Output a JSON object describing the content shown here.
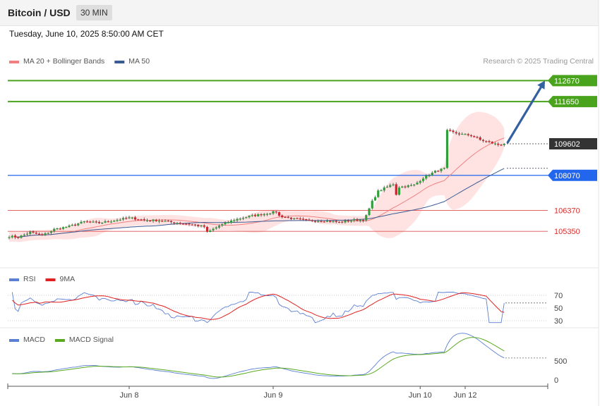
{
  "header": {
    "title": "Bitcoin / USD",
    "timeframe": "30 MIN"
  },
  "date_label": "Tuesday, June 10, 2025 8:50:00 AM CET",
  "copyright": "Research © 2025 Trading Central",
  "colors": {
    "price_text": "#333333",
    "resistance": "#4aa31c",
    "support_blue": "#2266ee",
    "support_red": "#e05050",
    "ma20": "#f08080",
    "ma50": "#3a5a92",
    "band_fill": "#ffdede",
    "candle_up": "#2f9e3b",
    "candle_down": "#c8262e",
    "last_price_bg": "#333333",
    "arrow": "#33609e",
    "rsi": "#5b7fd3",
    "rsi_ma": "#e12020",
    "macd": "#5b7fd3",
    "macd_signal": "#5aaa20"
  },
  "chart_data": [
    {
      "type": "candlestick",
      "panel": "price",
      "legend": [
        {
          "label": "MA 20 + Bollinger Bands",
          "color": "#f08080"
        },
        {
          "label": "MA 50",
          "color": "#3a5a92"
        }
      ],
      "levels": [
        {
          "value": 112670,
          "label": "112670",
          "kind": "resistance",
          "style": "line",
          "color": "#4aa31c"
        },
        {
          "value": 111650,
          "label": "111650",
          "kind": "resistance",
          "style": "line",
          "color": "#4aa31c"
        },
        {
          "value": 109602,
          "label": "109602",
          "kind": "last",
          "style": "dotted",
          "color": "#333333"
        },
        {
          "value": 108070,
          "label": "108070",
          "kind": "pivot",
          "style": "line",
          "color": "#2266ee"
        },
        {
          "value": 106370,
          "label": "106370",
          "kind": "support",
          "style": "thin",
          "color": "#e05050"
        },
        {
          "value": 105350,
          "label": "105350",
          "kind": "support",
          "style": "thin",
          "color": "#e05050"
        }
      ],
      "price_anchors": [
        [
          0,
          105110
        ],
        [
          3,
          105060
        ],
        [
          7,
          105310
        ],
        [
          11,
          105150
        ],
        [
          15,
          105450
        ],
        [
          20,
          105590
        ],
        [
          25,
          105820
        ],
        [
          30,
          105760
        ],
        [
          35,
          105880
        ],
        [
          40,
          106010
        ],
        [
          45,
          105900
        ],
        [
          50,
          105880
        ],
        [
          55,
          105780
        ],
        [
          60,
          105700
        ],
        [
          65,
          105580
        ],
        [
          66,
          105300
        ],
        [
          70,
          105620
        ],
        [
          75,
          105910
        ],
        [
          80,
          106080
        ],
        [
          85,
          106200
        ],
        [
          89,
          106310
        ],
        [
          90,
          106100
        ],
        [
          95,
          105950
        ],
        [
          100,
          105870
        ],
        [
          105,
          105860
        ],
        [
          110,
          105790
        ],
        [
          115,
          105900
        ],
        [
          118,
          105920
        ],
        [
          119,
          106100
        ],
        [
          121,
          106800
        ],
        [
          123,
          107300
        ],
        [
          128,
          107650
        ],
        [
          129,
          107150
        ],
        [
          130,
          107500
        ],
        [
          135,
          107600
        ],
        [
          138,
          107950
        ],
        [
          142,
          108260
        ],
        [
          145,
          108400
        ],
        [
          146,
          110230
        ],
        [
          148,
          110150
        ],
        [
          150,
          110080
        ],
        [
          154,
          110010
        ],
        [
          157,
          109790
        ],
        [
          160,
          109670
        ],
        [
          163,
          109560
        ],
        [
          165,
          109602
        ]
      ],
      "arrow_target": 112670,
      "x_ticks": [
        {
          "index": 40,
          "label": "Jun 8"
        },
        {
          "index": 88,
          "label": "Jun 9"
        },
        {
          "index": 137,
          "label": "Jun 10"
        },
        {
          "index": 152,
          "label": "Jun 12"
        }
      ]
    },
    {
      "type": "line",
      "panel": "rsi",
      "legend": [
        {
          "label": "RSI",
          "color": "#5b7fd3"
        },
        {
          "label": "9MA",
          "color": "#e12020"
        }
      ],
      "y_ticks": [
        70,
        50,
        30
      ],
      "ylim": [
        25,
        75
      ],
      "current_rsi": 58
    },
    {
      "type": "line",
      "panel": "macd",
      "legend": [
        {
          "label": "MACD",
          "color": "#5b7fd3"
        },
        {
          "label": "MACD Signal",
          "color": "#5aaa20"
        }
      ],
      "y_ticks": [
        500,
        0
      ]
    }
  ]
}
